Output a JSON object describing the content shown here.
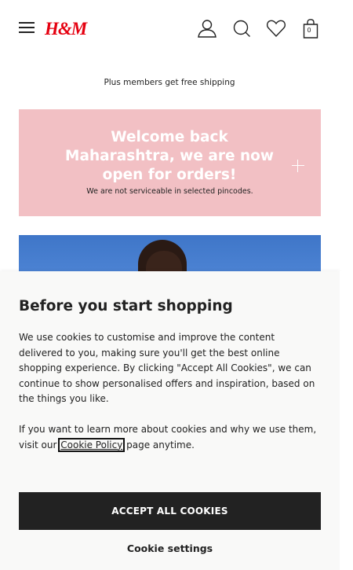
{
  "header": {
    "logo_text": "H&M",
    "logo_color": "#e50010",
    "icons": [
      "menu-icon",
      "user-icon",
      "search-icon",
      "heart-icon",
      "bag-icon"
    ],
    "bag_count": "0"
  },
  "promo": {
    "text": "Plus members get free shipping"
  },
  "banner": {
    "title": "Welcome back Maharashtra, we are now open for orders!",
    "subtitle": "We are not serviceable in selected pincodes.",
    "background": "#f2c0c4",
    "expand_icon": "plus-icon"
  },
  "cookie_modal": {
    "title": "Before you start shopping",
    "paragraph1": "We use cookies to customise and improve the content delivered to you, making sure you'll get the best online shopping experience. By clicking \"Accept All Cookies\", we can continue to show personalised offers and inspiration, based on the things you like.",
    "paragraph2_prefix": "If you want to learn more about cookies and why we use them, visit our",
    "cookie_policy_link": "Cookie Policy",
    "paragraph2_suffix": "page anytime.",
    "accept_label": "ACCEPT ALL COOKIES",
    "settings_label": "Cookie settings"
  }
}
